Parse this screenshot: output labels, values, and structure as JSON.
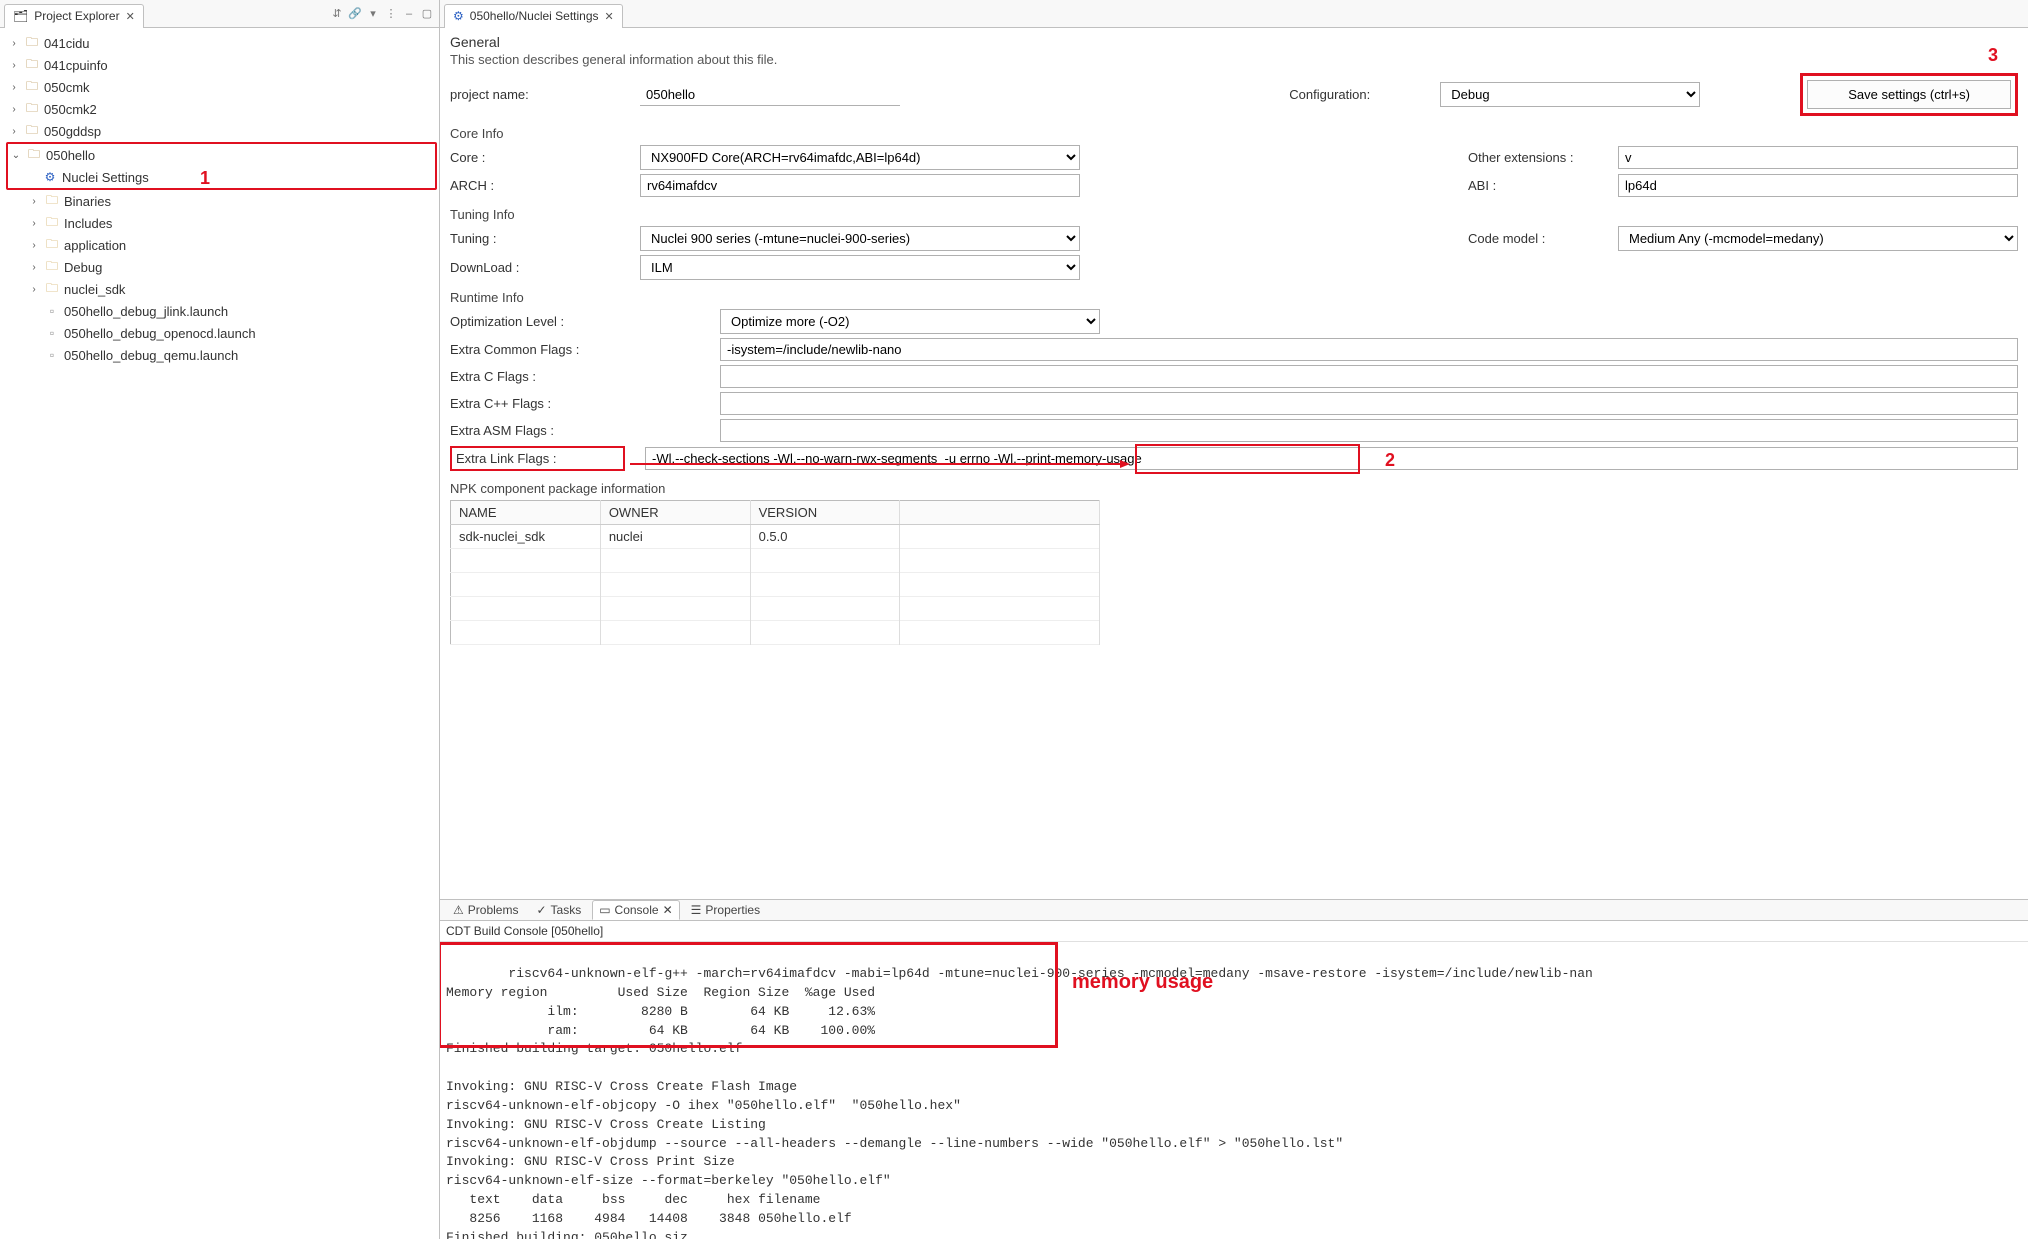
{
  "explorer": {
    "title": "Project Explorer",
    "projects": [
      "041cidu",
      "041cpuinfo",
      "050cmk",
      "050cmk2",
      "050gddsp"
    ],
    "open_project": "050hello",
    "open_children_before": [],
    "nuclei_settings_label": "Nuclei Settings",
    "open_children_after": [
      {
        "kind": "folder",
        "label": "Binaries"
      },
      {
        "kind": "folder",
        "label": "Includes"
      },
      {
        "kind": "folder",
        "label": "application"
      },
      {
        "kind": "folder",
        "label": "Debug"
      },
      {
        "kind": "folder",
        "label": "nuclei_sdk"
      },
      {
        "kind": "file",
        "label": "050hello_debug_jlink.launch"
      },
      {
        "kind": "file",
        "label": "050hello_debug_openocd.launch"
      },
      {
        "kind": "file",
        "label": "050hello_debug_qemu.launch"
      }
    ]
  },
  "editor": {
    "tab_title": "050hello/Nuclei Settings"
  },
  "general": {
    "heading": "General",
    "desc": "This section describes general information about this file.",
    "project_name_label": "project name:",
    "project_name": "050hello",
    "configuration_label": "Configuration:",
    "configuration": "Debug",
    "save_button": "Save settings (ctrl+s)"
  },
  "core_info": {
    "heading": "Core Info",
    "core_label": "Core :",
    "core": "NX900FD Core(ARCH=rv64imafdc,ABI=lp64d)",
    "arch_label": "ARCH :",
    "arch": "rv64imafdcv",
    "other_ext_label": "Other extensions :",
    "other_ext": "v",
    "abi_label": "ABI :",
    "abi": "lp64d"
  },
  "tuning": {
    "heading": "Tuning Info",
    "tuning_label": "Tuning :",
    "tuning": "Nuclei 900 series (-mtune=nuclei-900-series)",
    "download_label": "DownLoad :",
    "download": "ILM",
    "codemodel_label": "Code model :",
    "codemodel": "Medium Any (-mcmodel=medany)"
  },
  "runtime": {
    "heading": "Runtime Info",
    "opt_label": "Optimization Level :",
    "opt": "Optimize more (-O2)",
    "common_label": "Extra Common Flags :",
    "common": "-isystem=/include/newlib-nano",
    "cflags_label": "Extra C Flags :",
    "cflags": "",
    "cxx_label": "Extra C++ Flags :",
    "cxx": "",
    "asm_label": "Extra ASM Flags :",
    "asm": "",
    "link_label": "Extra Link Flags :",
    "link": "-Wl,--check-sections -Wl,--no-warn-rwx-segments  -u errno -Wl,--print-memory-usage"
  },
  "npk": {
    "heading": "NPK component package information",
    "headers": {
      "name": "NAME",
      "owner": "OWNER",
      "version": "VERSION"
    },
    "row": {
      "name": "sdk-nuclei_sdk",
      "owner": "nuclei",
      "version": "0.5.0"
    }
  },
  "bottom": {
    "tabs": {
      "problems": "Problems",
      "tasks": "Tasks",
      "console": "Console",
      "properties": "Properties"
    },
    "caption": "CDT Build Console [050hello]",
    "text": "riscv64-unknown-elf-g++ -march=rv64imafdcv -mabi=lp64d -mtune=nuclei-900-series -mcmodel=medany -msave-restore -isystem=/include/newlib-nan\nMemory region         Used Size  Region Size  %age Used\n             ilm:        8280 B        64 KB     12.63%\n             ram:         64 KB        64 KB    100.00%\nFinished building target: 050hello.elf\n \nInvoking: GNU RISC-V Cross Create Flash Image\nriscv64-unknown-elf-objcopy -O ihex \"050hello.elf\"  \"050hello.hex\"\nInvoking: GNU RISC-V Cross Create Listing\nriscv64-unknown-elf-objdump --source --all-headers --demangle --line-numbers --wide \"050hello.elf\" > \"050hello.lst\"\nInvoking: GNU RISC-V Cross Print Size\nriscv64-unknown-elf-size --format=berkeley \"050hello.elf\"\n   text\t   data\t    bss\t    dec\t    hex\tfilename\n   8256\t   1168\t   4984\t  14408\t   3848\t050hello.elf\nFinished building: 050hello.siz",
    "mem_label": "memory usage"
  },
  "ann": {
    "one": "1",
    "two": "2",
    "three": "3"
  }
}
